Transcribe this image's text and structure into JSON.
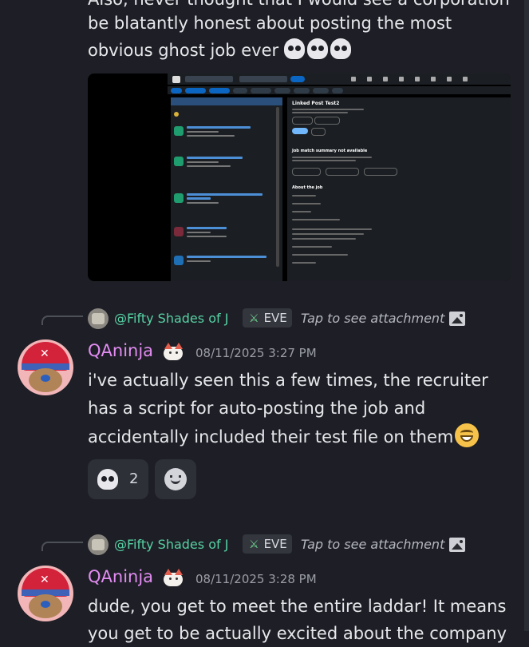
{
  "message1": {
    "partial_line": "Also, never thought that I would see a corporation",
    "line2": "be blatantly honest about posting the most",
    "line3": "obvious ghost job ever",
    "emoji": [
      "skull",
      "skull",
      "skull"
    ]
  },
  "attachment_screenshot": {
    "job_title": "Linked Post Test2",
    "summary_heading": "Job match summary not available",
    "section_heading": "About the job"
  },
  "reply1": {
    "name": "@Fifty Shades of J",
    "tag": "EVE",
    "tap_text": "Tap to see attachment",
    "icon": "image-icon"
  },
  "message2": {
    "username": "QAninja",
    "timestamp": "08/11/2025 3:27 PM",
    "line1": "i've actually seen this a few times, the recruiter",
    "line2": "has a script for auto-posting the job and",
    "line3": "accidentally included their test file on them",
    "emoji": "grinning-face"
  },
  "reactions": [
    {
      "emoji": "skull",
      "count": "2"
    },
    {
      "emoji": "add-reaction",
      "count": ""
    }
  ],
  "reply2": {
    "name": "@Fifty Shades of J",
    "tag": "EVE",
    "tap_text": "Tap to see attachment",
    "icon": "image-icon"
  },
  "message3": {
    "username": "QAninja",
    "timestamp": "08/11/2025 3:28 PM",
    "line1": "dude, you get to meet the entire laddar!  It means",
    "line2_partial": "you get to be actually excited about the company"
  },
  "colors": {
    "background": "#1e1f26",
    "username": "#e28cf2",
    "reply_name": "#56d1a3"
  }
}
